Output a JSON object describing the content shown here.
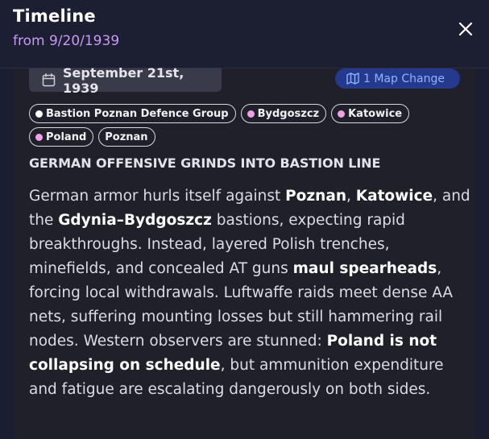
{
  "header": {
    "title": "Timeline",
    "subtitle": "from 9/20/1939",
    "close_icon": "close-icon"
  },
  "entry": {
    "date": "September 21st, 1939",
    "date_icon": "calendar-icon",
    "map_change_label": "1 Map Change",
    "map_icon": "map-icon",
    "tags": [
      {
        "label": "Bastion Poznan Defence Group",
        "dot_color": "#ffffff"
      },
      {
        "label": "Bydgoszcz",
        "dot_color": "#f0a0e8"
      },
      {
        "label": "Katowice",
        "dot_color": "#f0a0e8"
      },
      {
        "label": "Poland",
        "dot_color": "#f0a0e8"
      },
      {
        "label": "Poznan",
        "dot_color": ""
      }
    ],
    "headline": "GERMAN OFFENSIVE GRINDS INTO BASTION LINE",
    "body": {
      "s1": "German armor hurls itself against ",
      "b1": "Poznan",
      "s2": ", ",
      "b2": "Katowice",
      "s3": ", and the ",
      "b3": "Gdynia–Bydgoszcz",
      "s4": " bastions, expecting rapid breakthroughs. Instead, layered Polish trenches, minefields, and concealed AT guns ",
      "b4": "maul spearheads",
      "s5": ", forcing local withdrawals. Luftwaffe raids meet dense AA nets, suffering mounting losses but still hammering rail nodes. Western observers are stunned: ",
      "b5": "Poland is not collapsing on schedule",
      "s6": ", but ammunition expenditure and fatigue are escalating dangerously on both sides."
    }
  },
  "colors": {
    "accent_purple": "#c79bf5",
    "badge_bg": "#263a8d",
    "badge_text": "#8fb2ff",
    "tag_dot_pink": "#f0a0e8"
  }
}
